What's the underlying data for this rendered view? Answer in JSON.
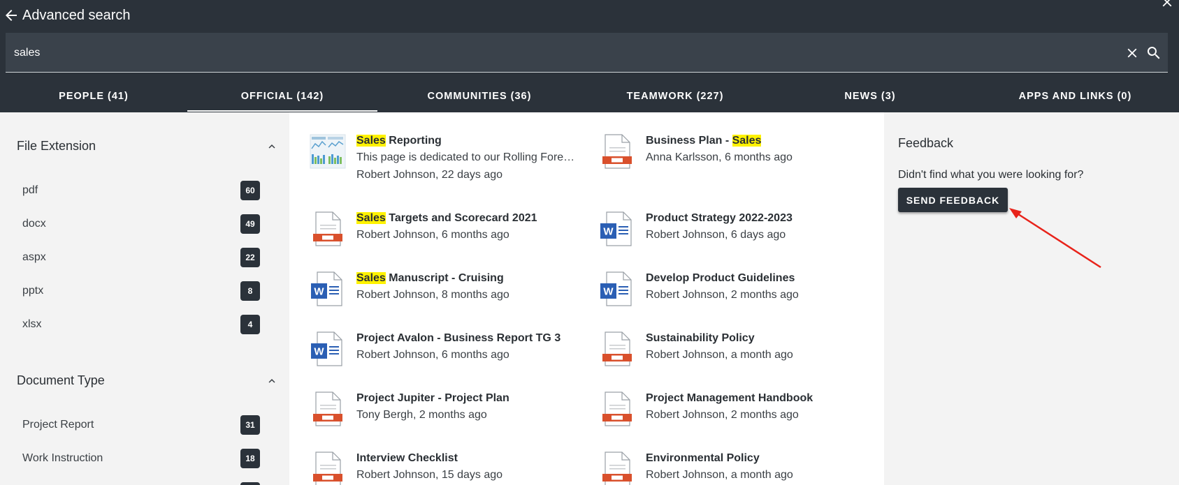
{
  "header": {
    "title": "Advanced search",
    "back_icon": "arrow-left-icon",
    "close_icon": "close-icon"
  },
  "search": {
    "value": "sales",
    "placeholder": ""
  },
  "tabs": [
    {
      "label": "PEOPLE (41)",
      "active": false
    },
    {
      "label": "OFFICIAL (142)",
      "active": true
    },
    {
      "label": "COMMUNITIES (36)",
      "active": false
    },
    {
      "label": "TEAMWORK (227)",
      "active": false
    },
    {
      "label": "NEWS (3)",
      "active": false
    },
    {
      "label": "APPS AND LINKS (0)",
      "active": false
    }
  ],
  "facets": [
    {
      "title": "File Extension",
      "items": [
        {
          "label": "pdf",
          "count": "60"
        },
        {
          "label": "docx",
          "count": "49"
        },
        {
          "label": "aspx",
          "count": "22"
        },
        {
          "label": "pptx",
          "count": "8"
        },
        {
          "label": "xlsx",
          "count": "4"
        }
      ]
    },
    {
      "title": "Document Type",
      "items": [
        {
          "label": "Project Report",
          "count": "31"
        },
        {
          "label": "Work Instruction",
          "count": "18"
        }
      ]
    }
  ],
  "results": [
    {
      "title_pre": "",
      "title_hl": "Sales",
      "title_post": " Reporting",
      "snippet": "This page is dedicated to our Rolling Forec...",
      "meta": "Robert Johnson, 22 days ago",
      "icon": "page-thumbnail-icon"
    },
    {
      "title_pre": "Business Plan - ",
      "title_hl": "Sales",
      "title_post": "",
      "snippet": "",
      "meta": "Anna Karlsson, 6 months ago",
      "icon": "pdf-file-icon"
    },
    {
      "title_pre": "",
      "title_hl": "Sales",
      "title_post": " Targets and Scorecard 2021",
      "snippet": "",
      "meta": "Robert Johnson, 6 months ago",
      "icon": "pdf-file-icon"
    },
    {
      "title_pre": "Product Strategy 2022-2023",
      "title_hl": "",
      "title_post": "",
      "snippet": "",
      "meta": "Robert Johnson, 6 days ago",
      "icon": "word-file-icon"
    },
    {
      "title_pre": "",
      "title_hl": "Sales",
      "title_post": " Manuscript - Cruising",
      "snippet": "",
      "meta": "Robert Johnson, 8 months ago",
      "icon": "word-file-icon"
    },
    {
      "title_pre": "Develop Product Guidelines",
      "title_hl": "",
      "title_post": "",
      "snippet": "",
      "meta": "Robert Johnson, 2 months ago",
      "icon": "word-file-icon"
    },
    {
      "title_pre": "Project Avalon - Business Report TG 3",
      "title_hl": "",
      "title_post": "",
      "snippet": "",
      "meta": "Robert Johnson, 6 months ago",
      "icon": "word-file-icon"
    },
    {
      "title_pre": "Sustainability Policy",
      "title_hl": "",
      "title_post": "",
      "snippet": "",
      "meta": "Robert Johnson, a month ago",
      "icon": "pdf-file-icon"
    },
    {
      "title_pre": "Project Jupiter - Project Plan",
      "title_hl": "",
      "title_post": "",
      "snippet": "",
      "meta": "Tony Bergh, 2 months ago",
      "icon": "pdf-file-icon"
    },
    {
      "title_pre": "Project Management Handbook",
      "title_hl": "",
      "title_post": "",
      "snippet": "",
      "meta": "Robert Johnson, 2 months ago",
      "icon": "pdf-file-icon"
    },
    {
      "title_pre": "Interview Checklist",
      "title_hl": "",
      "title_post": "",
      "snippet": "",
      "meta": "Robert Johnson, 15 days ago",
      "icon": "pdf-file-icon"
    },
    {
      "title_pre": "Environmental Policy",
      "title_hl": "",
      "title_post": "",
      "snippet": "",
      "meta": "Robert Johnson, a month ago",
      "icon": "pdf-file-icon"
    }
  ],
  "feedback": {
    "title": "Feedback",
    "text": "Didn't find what you were looking for?",
    "button_label": "SEND FEEDBACK"
  },
  "colors": {
    "header_bg": "#2b323a",
    "search_bg": "#3a424b",
    "highlight": "#fff200",
    "pdf_red": "#d9502c",
    "word_blue": "#2b5fb4",
    "annotation_red": "#e8231a"
  }
}
